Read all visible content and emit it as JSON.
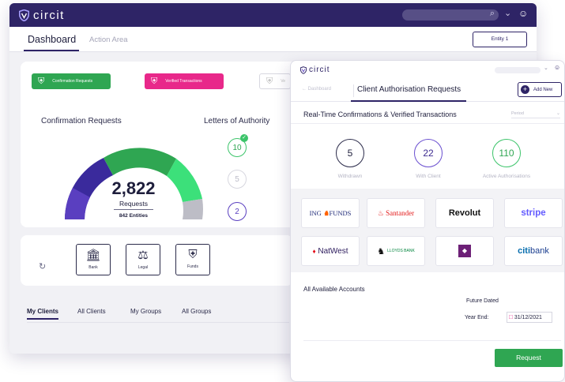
{
  "brand": {
    "name": "circit",
    "accent": "#2e2466",
    "green": "#2fa652",
    "pink": "#e8288a",
    "purple": "#5a3fc0"
  },
  "back_window": {
    "topbar": {
      "logo_text": "circit",
      "search_icon": "search-icon",
      "chevron_icon": "chevron-down-icon",
      "user_icon": "user-icon"
    },
    "tabs": {
      "dashboard": "Dashboard",
      "action_area": "Action Area"
    },
    "entity_button": "Entity 1",
    "categories": {
      "confirmation": "Confirmation Requests",
      "verified": "Verified Transactions",
      "third": "Ve"
    },
    "confirmation_requests": {
      "title": "Confirmation Requests",
      "total": "2,822",
      "label": "Requests",
      "entities": "842 Entities",
      "gauge": {
        "type": "gauge",
        "segments_hex": [
          "#3a2a9c",
          "#2fa652",
          "#3ce07a",
          "#bdbdc6"
        ]
      }
    },
    "letters_of_authority": {
      "title": "Letters of Authority",
      "values": [
        "10",
        "5",
        "2"
      ]
    },
    "doc_types": {
      "bank": "Bank",
      "legal": "Legal",
      "funds": "Funds"
    },
    "client_tabs": {
      "my_clients": "My Clients",
      "all_clients": "All Clients",
      "my_groups": "My Groups",
      "all_groups": "All Groups"
    }
  },
  "front_window": {
    "logo_text": "circit",
    "back_link": "← Dashboard",
    "title": "Client Authorisation Requests",
    "add_new": "Add New",
    "realtime_title": "Real-Time Confirmations & Verified Transactions",
    "period_placeholder": "Period",
    "stats": [
      {
        "value": "5",
        "label": "Withdrawn"
      },
      {
        "value": "22",
        "label": "With Client"
      },
      {
        "value": "110",
        "label": "Active Authorisations"
      }
    ],
    "banks": {
      "ing_a": "ING",
      "ing_b": "FUNDS",
      "santander": "Santander",
      "revolut": "Revolut",
      "stripe": "stripe",
      "natwest": "NatWest",
      "lloyds": "LLOYDS BANK",
      "citi_a": "citi",
      "citi_b": "bank"
    },
    "accounts_title": "All Available Accounts",
    "future_dated": "Future Dated",
    "year_end_label": "Year End:",
    "year_end_value": "31/12/2021",
    "request_button": "Request"
  }
}
